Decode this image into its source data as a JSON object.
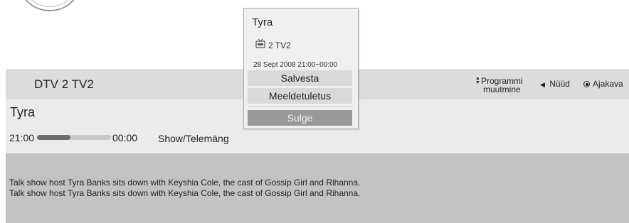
{
  "header": {
    "channel": "DTV 2  TV2",
    "controls": {
      "programme_label_line1": "Programmi",
      "programme_label_line2": "muutmine",
      "programme_icon": "up-down-arrows-icon",
      "now_label": "Nüüd",
      "now_icon": "left-triangle-icon",
      "schedule_label": "Ajakava",
      "schedule_icon": "radio-dot-icon"
    }
  },
  "programme": {
    "title": "Tyra",
    "start_time": "21:00",
    "end_time": "00:00",
    "progress": 0.45,
    "genre": "Show/Telemäng"
  },
  "description": {
    "line1": "Talk show host Tyra Banks sits down with Keyshia Cole, the cast of Gossip Girl and Rihanna.",
    "line2": "Talk show host Tyra Banks sits down with Keyshia Cole, the cast of Gossip Girl and Rihanna."
  },
  "popup": {
    "title": "Tyra",
    "channel_icon": "tv-icon",
    "channel": "2 TV2",
    "datetime": "28 Sept 2008 21:00~00:00",
    "buttons": {
      "save": "Salvesta",
      "reminder": "Meeldetuletus",
      "close": "Sulge"
    }
  },
  "colors": {
    "header_bg": "#dcdcdc",
    "info_bg": "#ebebeb",
    "description_bg": "#c3c3c3",
    "popup_bg": "#f0f0f0",
    "button_bg": "#d9d9d9",
    "close_button_bg": "#989898",
    "progress_fill": "#6e6e6e"
  }
}
